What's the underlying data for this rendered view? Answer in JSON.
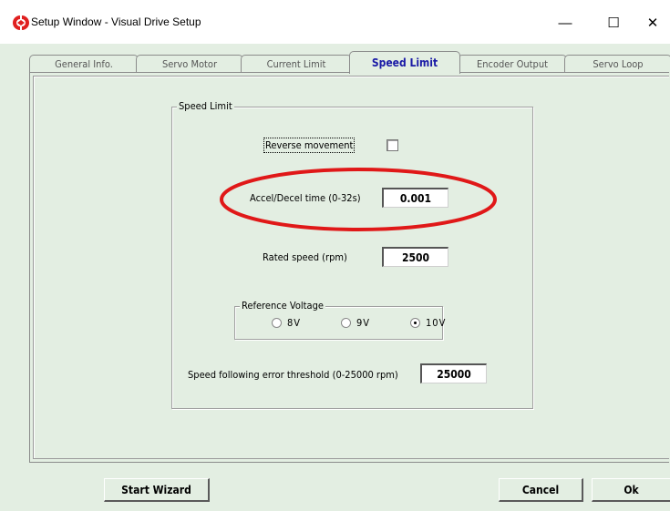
{
  "window": {
    "title": "Setup Window - Visual Drive Setup",
    "minimize_glyph": "—",
    "maximize_glyph": "☐",
    "close_glyph": "✕"
  },
  "tabs": [
    {
      "label": "General Info.",
      "active": false
    },
    {
      "label": "Servo Motor",
      "active": false
    },
    {
      "label": "Current Limit",
      "active": false
    },
    {
      "label": "Speed Limit",
      "active": true
    },
    {
      "label": "Encoder Output",
      "active": false
    },
    {
      "label": "Servo Loop",
      "active": false
    }
  ],
  "speed_limit": {
    "group_title": "Speed Limit",
    "reverse_movement_label": "Reverse movement",
    "reverse_movement_checked": false,
    "accel_decel_label": "Accel/Decel time (0-32s)",
    "accel_decel_value": "0.001",
    "rated_speed_label": "Rated speed (rpm)",
    "rated_speed_value": "2500",
    "reference_voltage": {
      "title": "Reference Voltage",
      "options": [
        {
          "label": "8V",
          "selected": false
        },
        {
          "label": "9V",
          "selected": false
        },
        {
          "label": "10V",
          "selected": true
        }
      ]
    },
    "error_threshold_label": "Speed following error threshold (0-25000 rpm)",
    "error_threshold_value": "25000"
  },
  "buttons": {
    "start_wizard": "Start Wizard",
    "cancel": "Cancel",
    "ok": "Ok"
  },
  "colors": {
    "background": "#e3eee2",
    "active_tab_text": "#1a1aa6",
    "highlight_ellipse": "#e01818"
  }
}
